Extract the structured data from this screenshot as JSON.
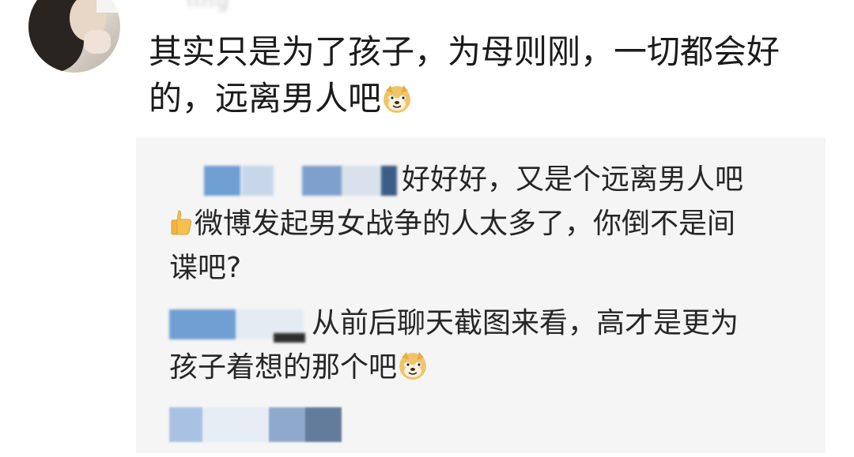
{
  "comment": {
    "username_partial": "ling",
    "text_lines": [
      "其实只是为了孩子，为母则刚，一切都会好",
      "的，远离男人吧"
    ],
    "trailing_emoji": "doge-emoji"
  },
  "replies": [
    {
      "lines": [
        "好好好，又是个远离男人吧",
        "微博发起男女战争的人太多了，你倒不是间",
        "谍吧?"
      ],
      "emojis": [
        "thumbs-up-emoji"
      ]
    },
    {
      "lines": [
        "从前后聊天截图来看，高才是更为",
        "孩子着想的那个吧"
      ],
      "emojis": [
        "doge-emoji"
      ]
    }
  ],
  "colors": {
    "reply_bg": "#f5f5f5",
    "text": "#1b1b1b",
    "blur_blue": "#7fa6d6"
  }
}
